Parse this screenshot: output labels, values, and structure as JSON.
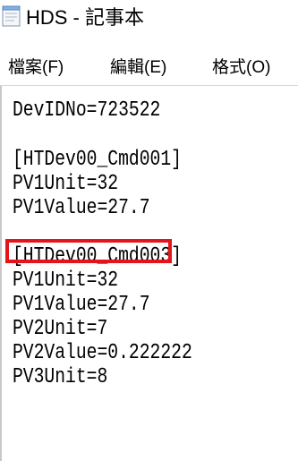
{
  "window": {
    "title": "HDS - 記事本"
  },
  "menubar": {
    "items": [
      "檔案(F)",
      "編輯(E)",
      "格式(O)"
    ]
  },
  "editor": {
    "lines": [
      "DevIDNo=723522",
      "",
      "[HTDev00_Cmd001]",
      "PV1Unit=32",
      "PV1Value=27.7",
      "",
      "[HTDev00_Cmd003]",
      "PV1Unit=32",
      "PV1Value=27.7",
      "PV2Unit=7",
      "PV2Value=0.222222",
      "PV3Unit=8"
    ]
  },
  "highlight": {
    "color": "#e3141b",
    "target_line": "PV1Value=27.7"
  },
  "icons": {
    "app": "notepad-icon"
  }
}
